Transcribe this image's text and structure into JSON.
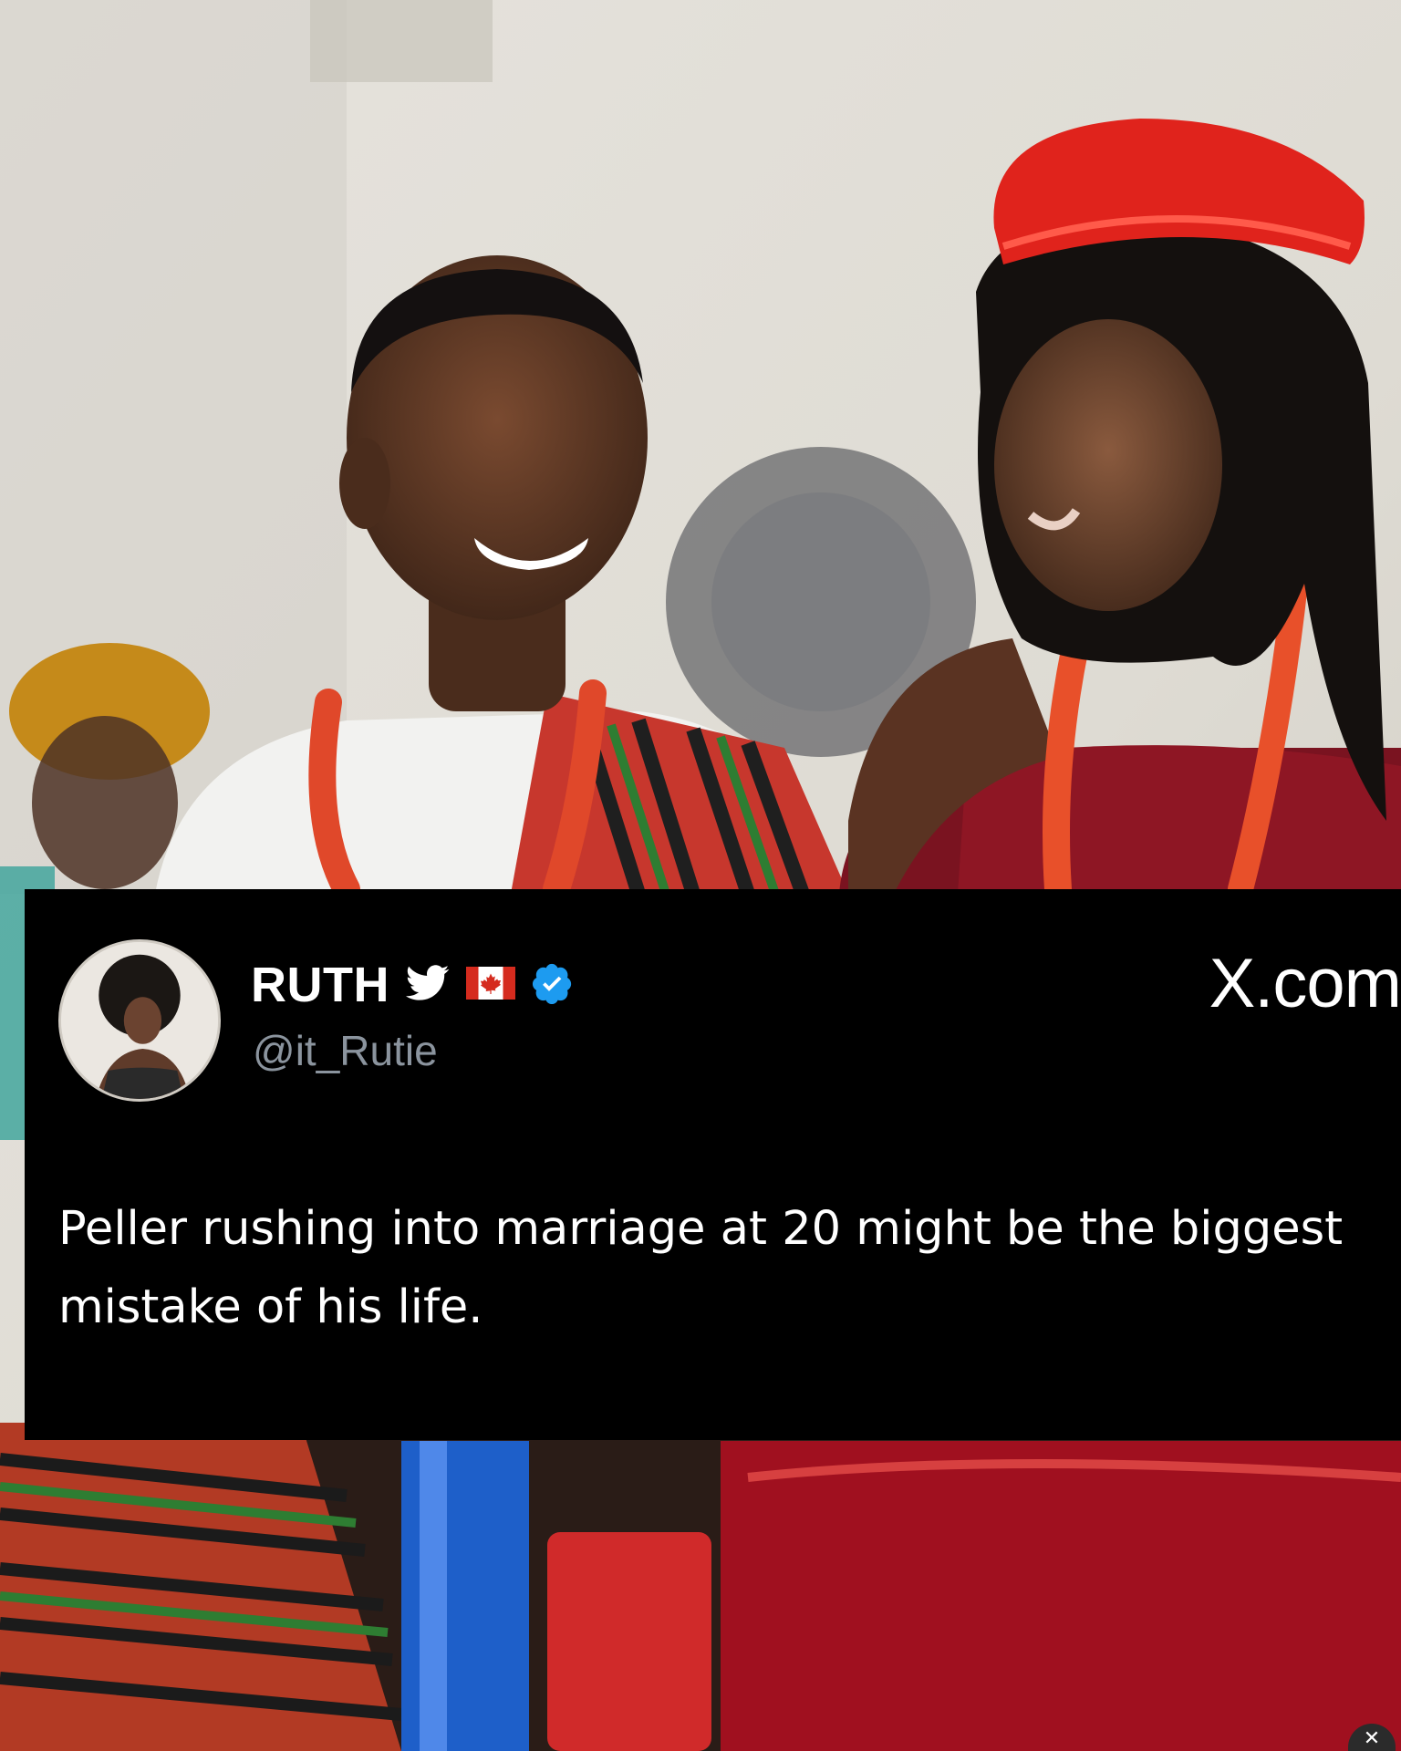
{
  "tweet": {
    "display_name": "RUTH",
    "handle": "@it_Rutie",
    "site": "X.com",
    "text": "Peller rushing into marriage at 20 might be the biggest mistake of his life."
  },
  "icons": {
    "bird": "twitter-bird-icon",
    "flag": "canada-flag-icon",
    "verified": "verified-badge-icon",
    "close": "close-icon"
  },
  "colors": {
    "card_background": "#000000",
    "verified_blue": "#1d9bf0",
    "handle_gray": "#8b949e"
  },
  "corner_button": {
    "glyph": "✕"
  }
}
